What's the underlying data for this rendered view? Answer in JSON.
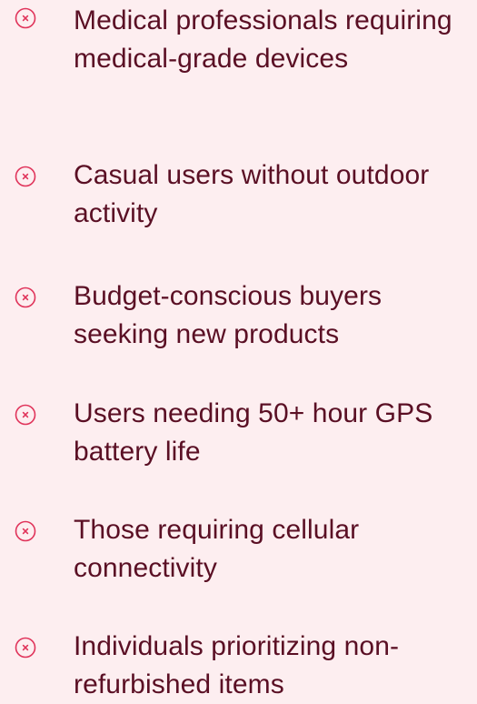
{
  "colors": {
    "background": "#fdeef0",
    "text": "#5a0f24",
    "icon": "#e0335a"
  },
  "icon": "circle-x-icon",
  "not_for_list": [
    {
      "label": "Medical professionals requiring medical-grade devices"
    },
    {
      "label": "Casual users without outdoor activity"
    },
    {
      "label": "Budget-conscious buyers seeking new products"
    },
    {
      "label": "Users needing 50+ hour GPS battery life"
    },
    {
      "label": "Those requiring cellular connectivity"
    },
    {
      "label": "Individuals prioritizing non-refurbished items"
    }
  ]
}
